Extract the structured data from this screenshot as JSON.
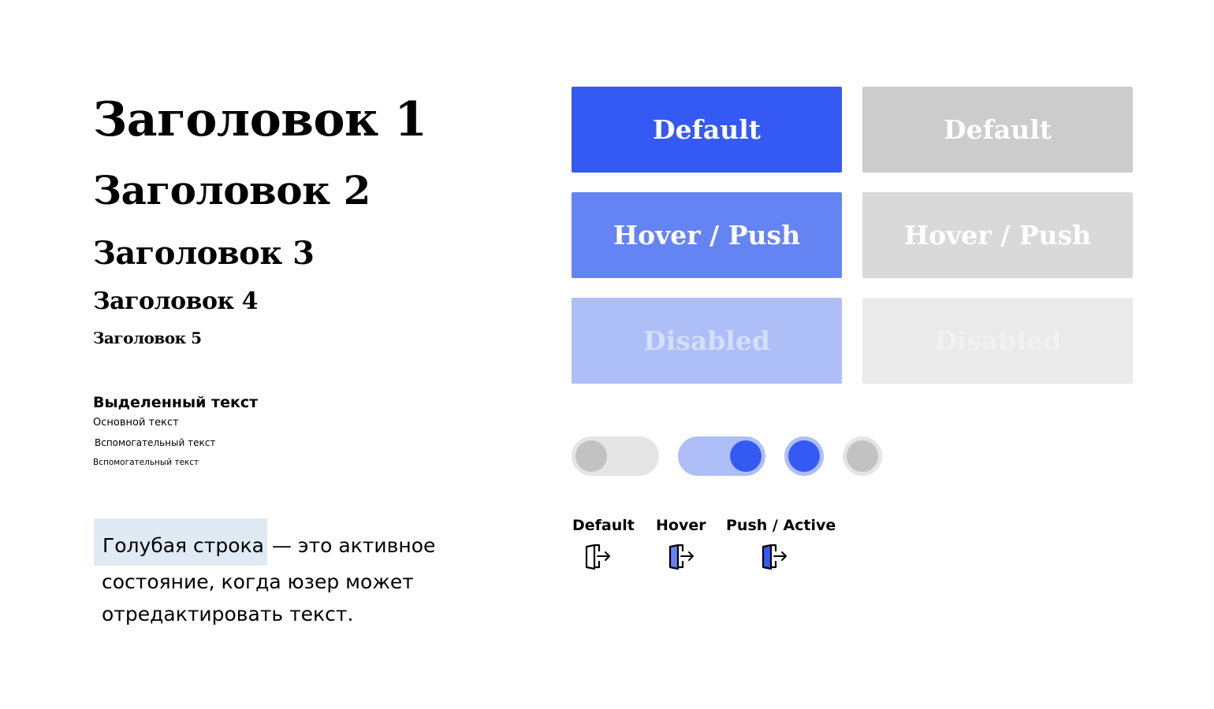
{
  "headings": {
    "h1": "Заголовок 1",
    "h2": "Заголовок 2",
    "h3": "Заголовок 3",
    "h4": "Заголовок 4",
    "h5": "Заголовок 5"
  },
  "text_styles": {
    "bold": "Выделенный текст",
    "main": "Основной текст",
    "aux1": "Вспомогательный текст",
    "aux2": "Вспомогательный текст"
  },
  "paragraph": {
    "highlight": "Голубая строка",
    "rest_line1": "— это активное",
    "line2": "состояние, когда юзер может",
    "line3": "отредактировать  текст."
  },
  "buttons_blue": {
    "default": "Default",
    "hover": "Hover / Push",
    "disabled": "Disabled"
  },
  "buttons_gray": {
    "default": "Default",
    "hover": "Hover / Push",
    "disabled": "Disabled"
  },
  "colors": {
    "accent": "#345af3",
    "accent_hover": "#6584f3",
    "accent_disabled": "#aebff8",
    "gray": "#cccccc",
    "highlight_bg": "#dfeaf5"
  },
  "controls": {
    "toggle_off": false,
    "toggle_on": true,
    "radio_on": true,
    "radio_off": false
  },
  "icon_states": {
    "default": "Default",
    "hover": "Hover",
    "push": "Push / Active",
    "icon": "logout-door-icon"
  }
}
